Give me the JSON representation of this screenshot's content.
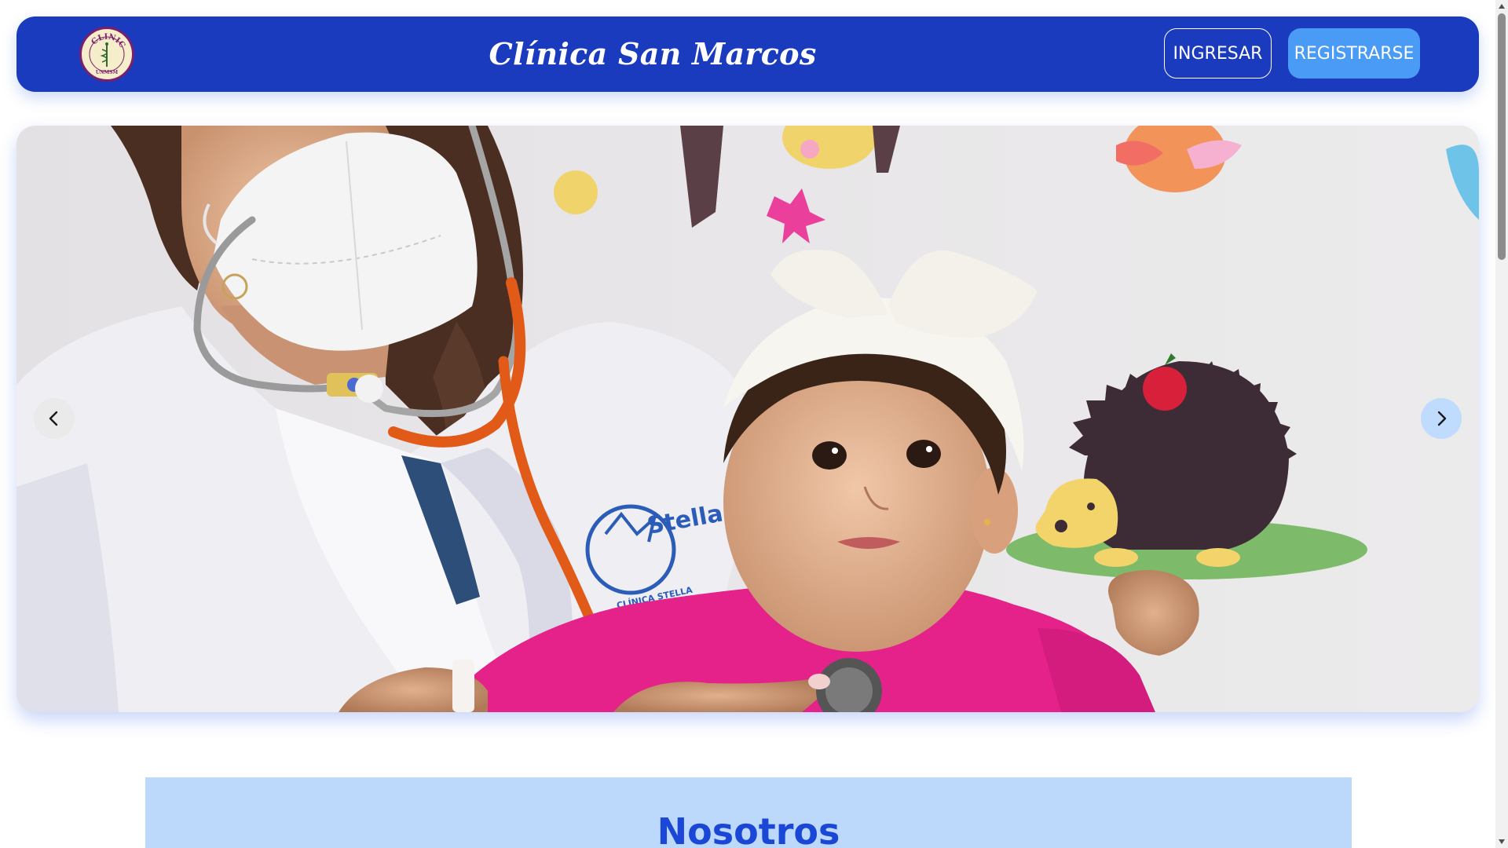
{
  "header": {
    "title": "Clínica San Marcos",
    "logo_icon": "clinic-logo-icon",
    "logo_text_top": "CLINICA",
    "logo_text_bottom": "UNMSM",
    "login_label": "INGRESAR",
    "register_label": "REGISTRARSE"
  },
  "carousel": {
    "prev_icon": "chevron-left-icon",
    "next_icon": "chevron-right-icon",
    "coat_logo_text": "Stella Maris",
    "coat_logo_subtext": "CLÍNICA STELLA"
  },
  "about": {
    "title": "Nosotros"
  },
  "colors": {
    "header_bg": "#1a3bbd",
    "register_bg": "#4a9bf5",
    "section_bg": "#bcd8fb",
    "section_title": "#1a47d6"
  }
}
